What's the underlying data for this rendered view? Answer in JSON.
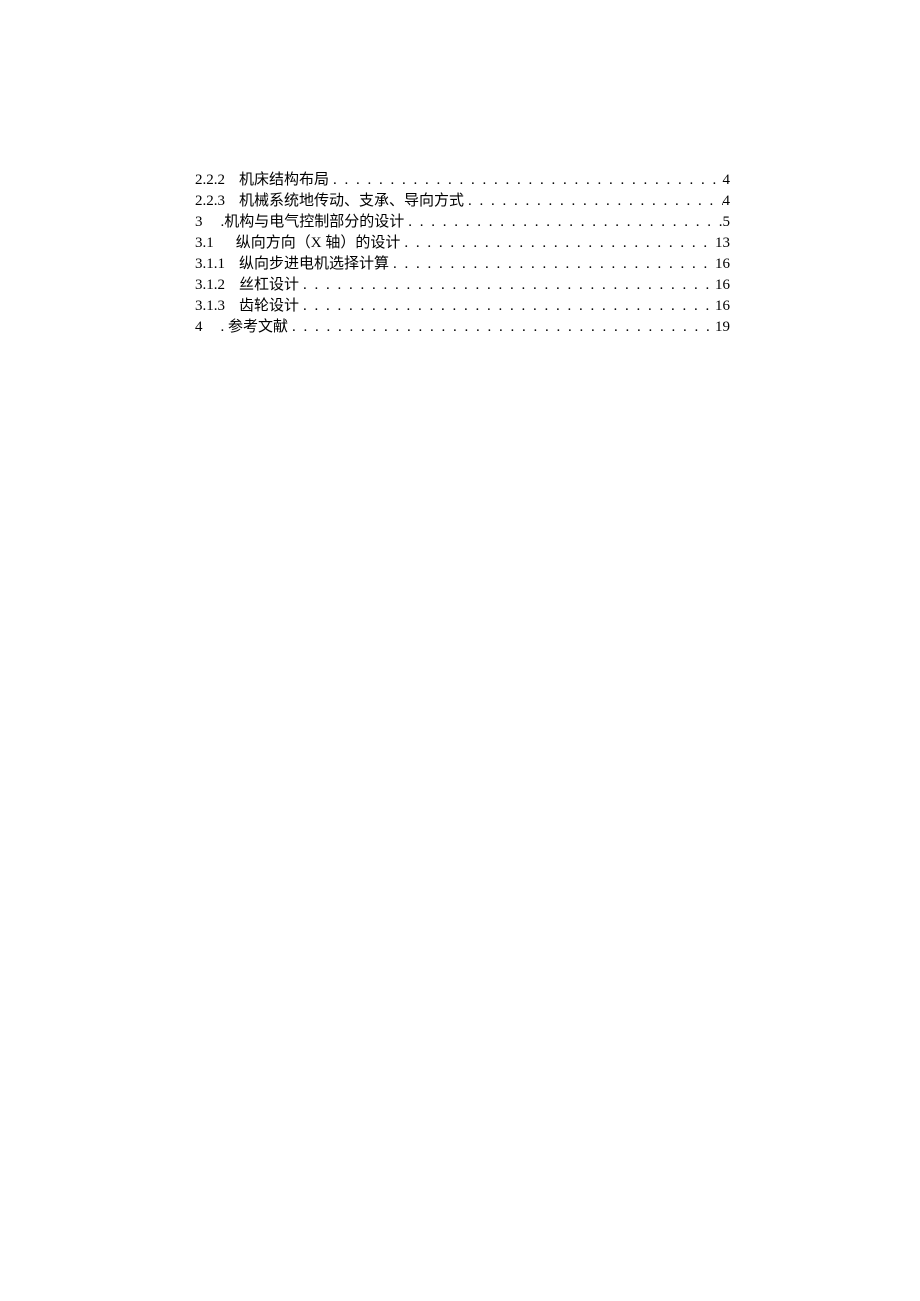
{
  "toc": {
    "entries": [
      {
        "number": "2.2.2",
        "gap": "gap-small",
        "title": "机床结构布局",
        "page": "4"
      },
      {
        "number": "2.2.3",
        "gap": "gap-small",
        "title": "机械系统地传动、支承、导向方式",
        "page": "4"
      },
      {
        "number": "3",
        "gap": "gap-med",
        "title": ".机构与电气控制部分的设计",
        "page": "5"
      },
      {
        "number": "3.1",
        "gap": "gap-large",
        "title": "纵向方向（X 轴）的设计",
        "page": "13"
      },
      {
        "number": "3.1.1",
        "gap": "gap-small",
        "title": "纵向步进电机选择计算",
        "page": "16"
      },
      {
        "number": "3.1.2",
        "gap": "gap-small",
        "title": "丝杠设计",
        "page": "16"
      },
      {
        "number": "3.1.3",
        "gap": "gap-small",
        "title": "齿轮设计",
        "page": "16"
      },
      {
        "number": "4",
        "gap": "gap-med",
        "title": ". 参考文献",
        "page": "19"
      }
    ]
  }
}
